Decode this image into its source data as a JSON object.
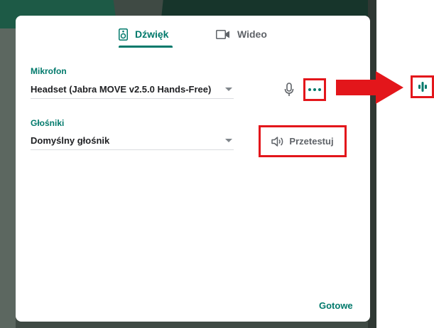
{
  "tabs": [
    {
      "label": "Dźwięk",
      "icon": "speaker-icon",
      "active": true
    },
    {
      "label": "Wideo",
      "icon": "video-camera-icon",
      "active": false
    }
  ],
  "microphone": {
    "label": "Mikrofon",
    "value": "Headset (Jabra MOVE v2.5.0 Hands-Free)",
    "icon": "microphone-icon",
    "more_icon": "more-horizontal-icon"
  },
  "speakers": {
    "label": "Głośniki",
    "value": "Domyślny głośnik",
    "test_label": "Przetestuj",
    "test_icon": "speaker-volume-icon"
  },
  "done_label": "Gotowe",
  "colors": {
    "accent": "#00796b",
    "annotation_red": "#e3161b",
    "text_primary": "#202124",
    "text_secondary": "#5f6368"
  }
}
